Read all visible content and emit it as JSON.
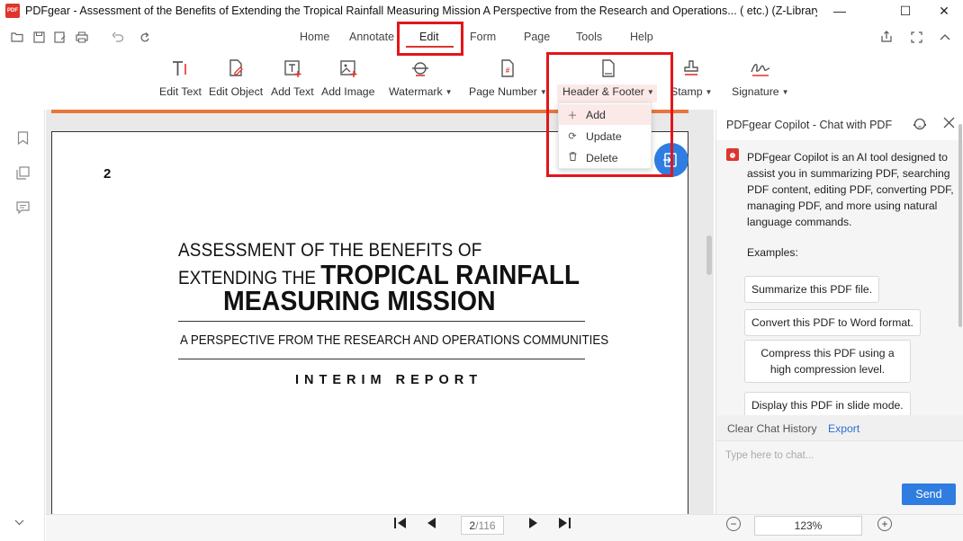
{
  "window": {
    "logo_text": "PDF",
    "title": "PDFgear - Assessment of the Benefits of Extending the Tropical Rainfall Measuring Mission A Perspective from the Research and Operations... ( etc.) (Z-Library).pdf",
    "minimize": "—",
    "maximize": "☐",
    "close": "✕"
  },
  "menu": {
    "items": [
      "Home",
      "Annotate",
      "Edit",
      "Form",
      "Page",
      "Tools",
      "Help"
    ],
    "active": "Edit"
  },
  "toolbar": {
    "tools": [
      {
        "label": "Edit Text"
      },
      {
        "label": "Edit Object"
      },
      {
        "label": "Add Text"
      },
      {
        "label": "Add Image"
      },
      {
        "label": "Watermark",
        "dropdown": true
      },
      {
        "label": "Page Number",
        "dropdown": true
      },
      {
        "label": "Header & Footer",
        "dropdown": true
      },
      {
        "label": "Stamp",
        "dropdown": true
      },
      {
        "label": "Signature",
        "dropdown": true
      }
    ]
  },
  "header_footer_menu": {
    "items": [
      {
        "label": "Add",
        "icon": "plus-icon"
      },
      {
        "label": "Update",
        "icon": "refresh-icon"
      },
      {
        "label": "Delete",
        "icon": "trash-icon"
      }
    ]
  },
  "document": {
    "page_label": "2",
    "line1": "ASSESSMENT OF THE BENEFITS OF",
    "line2_small": "EXTENDING THE ",
    "line2_big": "TROPICAL RAINFALL",
    "line3": "MEASURING MISSION",
    "subtitle": "A PERSPECTIVE FROM THE RESEARCH AND OPERATIONS COMMUNITIES",
    "report_type": "INTERIM REPORT"
  },
  "navigation": {
    "current_page": "2",
    "total_pages": "/116",
    "zoom": "123%"
  },
  "copilot": {
    "title": "PDFgear Copilot - Chat with PDF",
    "avatar_text": "⏰",
    "intro": "PDFgear Copilot is an AI tool designed to assist you in summarizing PDF, searching PDF content, editing PDF, converting PDF, managing PDF, and more using natural language commands.",
    "examples_label": "Examples:",
    "examples": [
      "Summarize this PDF file.",
      "Convert this PDF to Word format.",
      "Compress this PDF using a high compression level.",
      "Display this PDF in slide mode."
    ],
    "clear_label": "Clear Chat History",
    "export_label": "Export",
    "input_placeholder": "Type here to chat...",
    "send_label": "Send"
  },
  "colors": {
    "accent_red": "#e0352b",
    "highlight_box": "#e3151a",
    "primary_blue": "#2f7de0"
  }
}
